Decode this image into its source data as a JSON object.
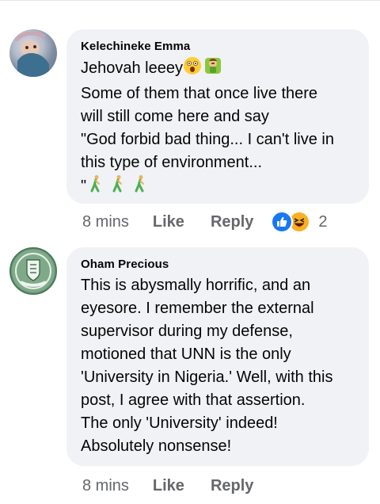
{
  "comments": [
    {
      "author": "Kelechineke Emma",
      "lines": [
        "Jehovah leeey",
        "Some of them that once live there",
        "will still come here and say",
        "\"God forbid bad thing... I can't live in",
        "this type of environment...",
        "\""
      ],
      "emoji_after_first_line": [
        "astonished-face-emoji",
        "person-facepalming-emoji"
      ],
      "emoji_last_line": [
        "person-walking-emoji",
        "person-walking-emoji",
        "person-walking-emoji"
      ],
      "time": "8 mins",
      "like_label": "Like",
      "reply_label": "Reply",
      "reactions": [
        "like",
        "haha"
      ],
      "reaction_count": "2"
    },
    {
      "author": "Oham Precious",
      "lines": [
        "This is abysmally horrific, and an",
        "eyesore. I remember the external",
        "supervisor during my defense,",
        "motioned that UNN is the only",
        "'University in Nigeria.' Well, with this",
        "post, I agree with that assertion.",
        "The only 'University' indeed!",
        "Absolutely nonsense!"
      ],
      "time": "8 mins",
      "like_label": "Like",
      "reply_label": "Reply"
    }
  ],
  "colors": {
    "bubble": "#f0f2f5",
    "meta_text": "#65676b",
    "like_blue": "#1877f2",
    "haha_yellow": "#f7b125"
  }
}
